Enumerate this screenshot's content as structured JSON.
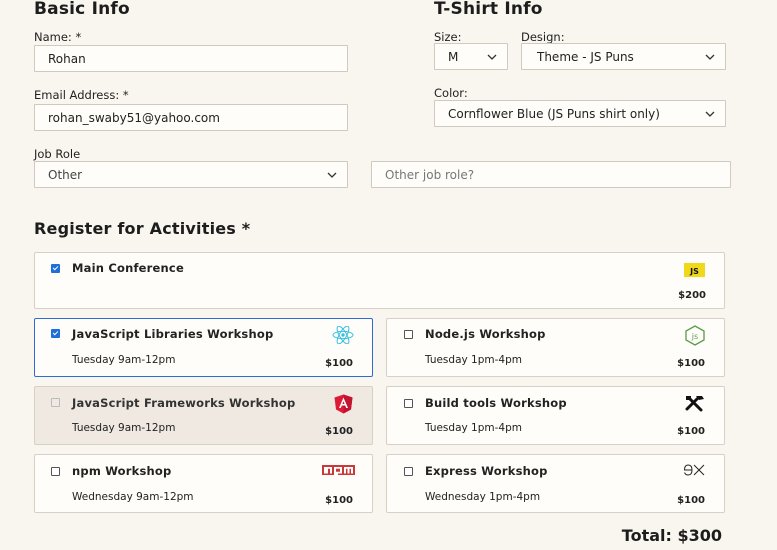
{
  "basic": {
    "heading": "Basic Info",
    "name_label": "Name: *",
    "name_value": "Rohan",
    "email_label": "Email Address: *",
    "email_value": "rohan_swaby51@yahoo.com",
    "job_label": "Job Role",
    "job_value": "Other",
    "other_job_placeholder": "Other job role?"
  },
  "tshirt": {
    "heading": "T-Shirt Info",
    "size_label": "Size:",
    "size_value": "M",
    "design_label": "Design:",
    "design_value": "Theme - JS Puns",
    "color_label": "Color:",
    "color_value": "Cornflower Blue (JS Puns shirt only)"
  },
  "activities": {
    "heading": "Register for Activities *",
    "main": {
      "title": "Main Conference",
      "price": "$200",
      "icon": "js-icon",
      "checked": true
    },
    "items": [
      {
        "title": "JavaScript Libraries Workshop",
        "time": "Tuesday 9am-12pm",
        "price": "$100",
        "icon": "react-icon",
        "checked": true,
        "disabled": false
      },
      {
        "title": "Node.js Workshop",
        "time": "Tuesday 1pm-4pm",
        "price": "$100",
        "icon": "nodejs-icon",
        "checked": false,
        "disabled": false
      },
      {
        "title": "JavaScript Frameworks Workshop",
        "time": "Tuesday 9am-12pm",
        "price": "$100",
        "icon": "angular-icon",
        "checked": false,
        "disabled": true
      },
      {
        "title": "Build tools Workshop",
        "time": "Tuesday 1pm-4pm",
        "price": "$100",
        "icon": "tools-icon",
        "checked": false,
        "disabled": false
      },
      {
        "title": "npm Workshop",
        "time": "Wednesday 9am-12pm",
        "price": "$100",
        "icon": "npm-icon",
        "checked": false,
        "disabled": false
      },
      {
        "title": "Express Workshop",
        "time": "Wednesday 1pm-4pm",
        "price": "$100",
        "icon": "express-icon",
        "checked": false,
        "disabled": false
      }
    ]
  },
  "total": "Total: $300",
  "colors": {
    "accent": "#2f6ad8",
    "checkbox": "#1e6fd9",
    "background": "#f9f5ef"
  }
}
